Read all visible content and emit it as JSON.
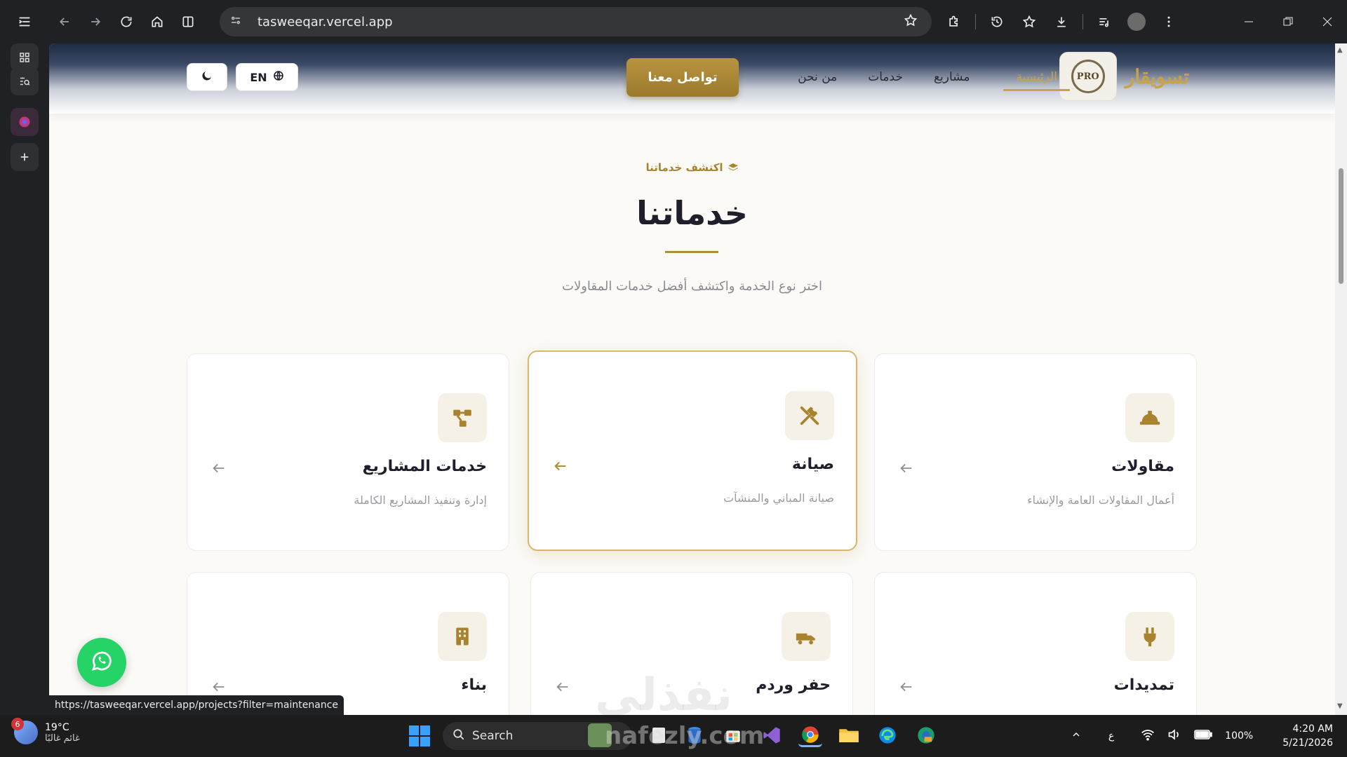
{
  "browser": {
    "url": "tasweeqar.vercel.app",
    "status_url": "https://tasweeqar.vercel.app/projects?filter=maintenance"
  },
  "header": {
    "brand": "تسويقار",
    "logo_text": "PRO",
    "nav": [
      {
        "label": "الرئيسية",
        "active": true
      },
      {
        "label": "مشاريع",
        "active": false
      },
      {
        "label": "خدمات",
        "active": false
      },
      {
        "label": "من نحن",
        "active": false
      }
    ],
    "contact": "تواصل معنا",
    "lang": "EN"
  },
  "section": {
    "eyebrow": "اكتشف خدماتنا",
    "title": "خدماتنا",
    "subtitle": "اختر نوع الخدمة واكتشف أفضل خدمات المقاولات"
  },
  "cards": [
    {
      "title": "مقاولات",
      "desc": "أعمال المقاولات العامة والإنشاء",
      "icon": "hard-hat-icon"
    },
    {
      "title": "صيانة",
      "desc": "صيانة المباني والمنشآت",
      "icon": "tools-icon"
    },
    {
      "title": "خدمات المشاريع",
      "desc": "إدارة وتنفيذ المشاريع الكاملة",
      "icon": "project-diagram-icon"
    },
    {
      "title": "تمديدات",
      "desc": "",
      "icon": "plug-icon"
    },
    {
      "title": "حفر وردم",
      "desc": "",
      "icon": "truck-icon"
    },
    {
      "title": "بناء",
      "desc": "",
      "icon": "building-icon"
    }
  ],
  "watermark": {
    "arabic": "نفذلي",
    "latin": "nafezly.com"
  },
  "taskbar": {
    "temp": "19°C",
    "weather": "غائم غالبًا",
    "weather_badge": "6",
    "search": "Search",
    "lang": "ع",
    "battery": "100%",
    "time": "4:20 AM",
    "date": "5/21/2026"
  },
  "colors": {
    "gold": "#b08d3a",
    "dark": "#1f1f2b",
    "whatsapp": "#25d366"
  }
}
